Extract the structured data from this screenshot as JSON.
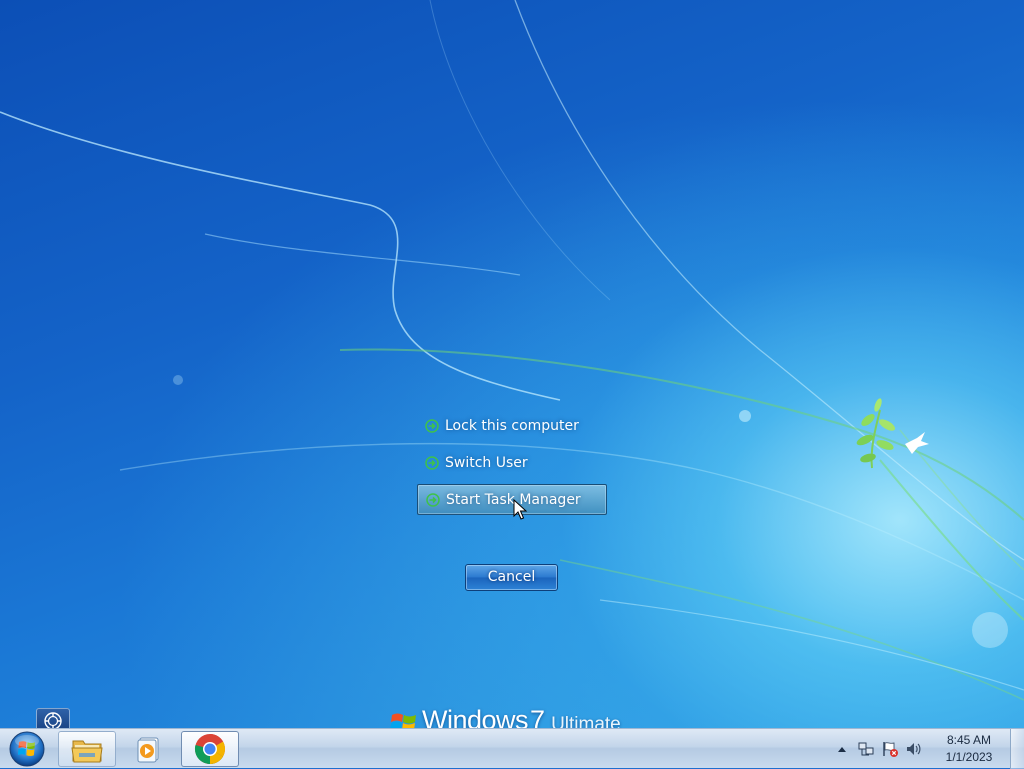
{
  "security_screen": {
    "options": [
      {
        "label": "Lock this computer",
        "selected": false
      },
      {
        "label": "Switch User",
        "selected": false
      },
      {
        "label": "Start Task Manager",
        "selected": true
      }
    ],
    "cancel_label": "Cancel"
  },
  "branding": {
    "word": "Windows",
    "version": "7",
    "edition": "Ultimate"
  },
  "taskbar": {
    "start": {
      "icon": "windows-orb-icon"
    },
    "pinned": [
      {
        "name": "windows-explorer",
        "icon": "folder-icon"
      },
      {
        "name": "media-player",
        "icon": "media-player-icon"
      },
      {
        "name": "chrome",
        "icon": "chrome-icon",
        "active": true
      }
    ],
    "tray": {
      "icons": [
        "show-hidden-icons-arrow",
        "network-icon",
        "action-center-flag-icon",
        "volume-icon"
      ],
      "time": "8:45 AM",
      "date": "1/1/2023"
    }
  },
  "colors": {
    "accent": "#1f6fcf",
    "arrow_green": "#3fc24a",
    "taskbar": "#c3d5ea"
  }
}
